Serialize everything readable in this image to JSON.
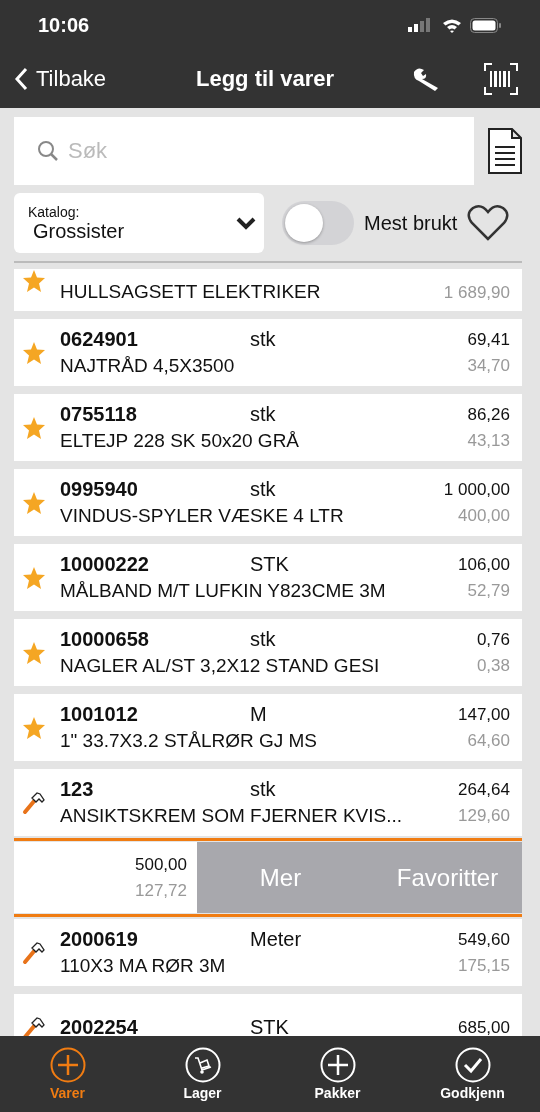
{
  "status_bar": {
    "time": "10:06"
  },
  "nav": {
    "back": "Tilbake",
    "title": "Legg til varer"
  },
  "search": {
    "placeholder": "Søk"
  },
  "catalog": {
    "label": "Katalog:",
    "value": "Grossister"
  },
  "toggle": {
    "label": "Mest brukt",
    "on": false
  },
  "items": [
    {
      "kind": "favorite",
      "name": "HULLSAGSETT ELEKTRIKER",
      "price2": "1 689,90"
    },
    {
      "kind": "favorite",
      "code": "0624901",
      "unit": "stk",
      "name": "NAJTRÅD 4,5X3500",
      "price1": "69,41",
      "price2": "34,70"
    },
    {
      "kind": "favorite",
      "code": "0755118",
      "unit": "stk",
      "name": "ELTEJP 228 SK 50x20 GRÅ",
      "price1": "86,26",
      "price2": "43,13"
    },
    {
      "kind": "favorite",
      "code": "0995940",
      "unit": "stk",
      "name": "VINDUS-SPYLER VÆSKE 4 LTR",
      "price1": "1 000,00",
      "price2": "400,00"
    },
    {
      "kind": "favorite",
      "code": "10000222",
      "unit": "STK",
      "name": "MÅLBAND M/T LUFKIN Y823CME 3M",
      "price1": "106,00",
      "price2": "52,79"
    },
    {
      "kind": "favorite",
      "code": "10000658",
      "unit": "stk",
      "name": "NAGLER AL/ST 3,2X12 STAND GESI",
      "price1": "0,76",
      "price2": "0,38"
    },
    {
      "kind": "favorite",
      "code": "1001012",
      "unit": "M",
      "name": "1\" 33.7X3.2 STÅLRØR GJ MS",
      "price1": "147,00",
      "price2": "64,60"
    },
    {
      "kind": "tool",
      "code": "123",
      "unit": "stk",
      "name": "ANSIKTSKREM SOM FJERNER KVIS...",
      "price1": "264,64",
      "price2": "129,60"
    },
    {
      "kind": "swiped",
      "price1": "500,00",
      "price2": "127,72",
      "actions": [
        "Mer",
        "Favoritter"
      ],
      "highlighted": true
    },
    {
      "kind": "tool",
      "code": "2000619",
      "unit": "Meter",
      "name": "110X3 MA RØR 3M",
      "price1": "549,60",
      "price2": "175,15"
    },
    {
      "kind": "tool",
      "code": "2002254",
      "unit": "STK",
      "price1": "685,00"
    }
  ],
  "tabs": [
    {
      "label": "Varer",
      "selected": true
    },
    {
      "label": "Lager",
      "selected": false
    },
    {
      "label": "Pakker",
      "selected": false
    },
    {
      "label": "Godkjenn",
      "selected": false
    }
  ]
}
